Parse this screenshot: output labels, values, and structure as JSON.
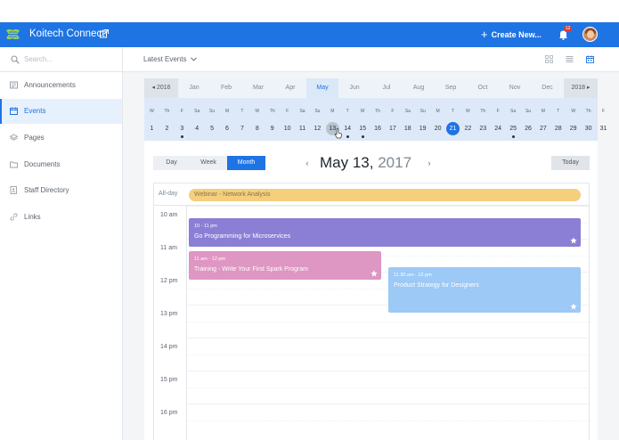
{
  "header": {
    "app_title": "Koitech Connect",
    "create_label": "Create New...",
    "notification_count": "12",
    "brand_color": "#1f74e4"
  },
  "search": {
    "placeholder": "Search..."
  },
  "sidebar": {
    "items": [
      {
        "label": "Announcements",
        "icon": "newspaper-icon",
        "active": false
      },
      {
        "label": "Events",
        "icon": "calendar-icon",
        "active": true
      },
      {
        "label": "Pages",
        "icon": "layers-icon",
        "active": false
      },
      {
        "label": "Documents",
        "icon": "folder-icon",
        "active": false
      },
      {
        "label": "Staff Directory",
        "icon": "contact-book-icon",
        "active": false
      },
      {
        "label": "Links",
        "icon": "link-icon",
        "active": false
      }
    ]
  },
  "filter": {
    "dropdown_label": "Latest Events"
  },
  "month_strip": {
    "prev_year": "2016",
    "next_year": "2018",
    "months": [
      "Jan",
      "Feb",
      "Mar",
      "Apr",
      "May",
      "Jun",
      "Jul",
      "Aug",
      "Sep",
      "Oct",
      "Nov",
      "Dec"
    ],
    "current_month": "May"
  },
  "day_strip": {
    "days": [
      {
        "dow": "W",
        "num": "1"
      },
      {
        "dow": "Th",
        "num": "2"
      },
      {
        "dow": "F",
        "num": "3",
        "dot": true
      },
      {
        "dow": "Sa",
        "num": "4"
      },
      {
        "dow": "Su",
        "num": "5"
      },
      {
        "dow": "M",
        "num": "6"
      },
      {
        "dow": "T",
        "num": "7"
      },
      {
        "dow": "W",
        "num": "8"
      },
      {
        "dow": "Th",
        "num": "9"
      },
      {
        "dow": "F",
        "num": "10"
      },
      {
        "dow": "Sa",
        "num": "11"
      },
      {
        "dow": "Su",
        "num": "12"
      },
      {
        "dow": "M",
        "num": "13",
        "selected": true
      },
      {
        "dow": "T",
        "num": "14",
        "dot": true
      },
      {
        "dow": "W",
        "num": "15",
        "dot": true
      },
      {
        "dow": "Th",
        "num": "16"
      },
      {
        "dow": "F",
        "num": "17"
      },
      {
        "dow": "Sa",
        "num": "18"
      },
      {
        "dow": "Su",
        "num": "19"
      },
      {
        "dow": "M",
        "num": "20"
      },
      {
        "dow": "T",
        "num": "21",
        "today": true
      },
      {
        "dow": "W",
        "num": "22"
      },
      {
        "dow": "Th",
        "num": "23"
      },
      {
        "dow": "F",
        "num": "24"
      },
      {
        "dow": "Sa",
        "num": "25",
        "dot": true
      },
      {
        "dow": "Su",
        "num": "26"
      },
      {
        "dow": "M",
        "num": "27"
      },
      {
        "dow": "T",
        "num": "28"
      },
      {
        "dow": "W",
        "num": "29"
      },
      {
        "dow": "Th",
        "num": "30"
      },
      {
        "dow": "F",
        "num": "31"
      }
    ]
  },
  "view_switch": {
    "day": "Day",
    "week": "Week",
    "month": "Month",
    "active": "Month"
  },
  "date_header": {
    "month_day": "May 13,",
    "year": "2017"
  },
  "today_label": "Today",
  "calendar": {
    "allday_label": "All-day",
    "allday_event": "Webinar - Network Analysis",
    "hours": [
      "10 am",
      "11 am",
      "12 pm",
      "13 pm",
      "14 pm",
      "15 pm",
      "16 pm"
    ],
    "events": [
      {
        "time": "10 - 11 pm",
        "title": "Go Programming for Microservices",
        "color": "#8a7fd5",
        "starred": true
      },
      {
        "time": "11 am - 12 pm",
        "title": "Training - Write Your First Spark Program",
        "color": "#de96c3",
        "starred": true
      },
      {
        "time": "11.30 am - 12 pm",
        "title": "Product Strategy for Designers",
        "color": "#9cc9f6",
        "starred": true
      }
    ]
  }
}
